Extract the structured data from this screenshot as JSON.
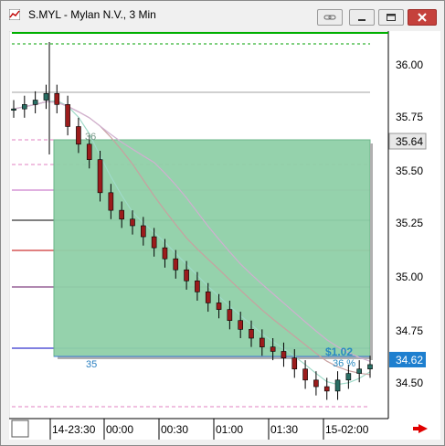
{
  "window": {
    "title": "S.MYL - Mylan N.V., 3 Min"
  },
  "price_axis": {
    "ticks": [
      "36.00",
      "35.75",
      "35.50",
      "35.25",
      "35.00",
      "34.75",
      "34.50"
    ],
    "current_label": "35.64",
    "last_label": "34.62"
  },
  "time_axis": {
    "ticks": [
      "14-23:30",
      "00:00",
      "00:30",
      "01:00",
      "01:30",
      "15-02:00"
    ]
  },
  "annotations": {
    "box_top_label": "36",
    "box_bottom_label": "35",
    "box_range_label": "$1.02",
    "box_sub_label": "36 %"
  },
  "colors": {
    "box_fill": "#8fd0a8",
    "up_candle": "#2a6e64",
    "down_candle": "#9b1c1c",
    "accent_arrow": "#e00000"
  },
  "chart_data": {
    "type": "candlestick",
    "title": "S.MYL - Mylan N.V., 3 Min",
    "x": [
      "14-23:30",
      "00:00",
      "00:30",
      "01:00",
      "01:30",
      "15-02:00"
    ],
    "ylim": [
      34.4,
      36.1
    ],
    "series": [
      {
        "name": "",
        "values": [
          35.78,
          35.8,
          35.82,
          35.85,
          35.8,
          35.7,
          35.62,
          35.55,
          35.4,
          35.32,
          35.28,
          35.25,
          35.2,
          35.15,
          35.1,
          35.05,
          35.0,
          34.95,
          34.9,
          34.87,
          34.82,
          34.78,
          34.74,
          34.7,
          34.68,
          34.65,
          34.6,
          34.55,
          34.52,
          34.5,
          34.55,
          34.58,
          34.6,
          34.62
        ]
      }
    ]
  }
}
